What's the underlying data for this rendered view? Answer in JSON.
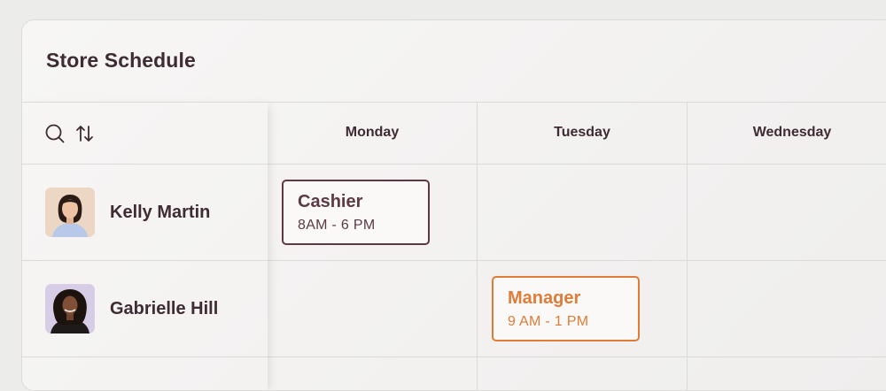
{
  "page": {
    "title": "Store Schedule"
  },
  "toolbar": {
    "icons": [
      "search-icon",
      "sort-icon"
    ]
  },
  "days": [
    "Monday",
    "Tuesday",
    "Wednesday"
  ],
  "employees": [
    {
      "name": "Kelly Martin"
    },
    {
      "name": "Gabrielle Hill"
    }
  ],
  "shifts": [
    {
      "role": "Cashier",
      "time": "8AM - 6 PM",
      "employee": "Kelly Martin",
      "day": "Monday",
      "color": "#5b3a45"
    },
    {
      "role": "Manager",
      "time": "9 AM - 1 PM",
      "employee": "Gabrielle Hill",
      "day": "Tuesday",
      "color": "#de7c39"
    }
  ],
  "colors": {
    "text": "#3f2b33",
    "cashier": "#5b3a45",
    "manager": "#de7c39"
  }
}
